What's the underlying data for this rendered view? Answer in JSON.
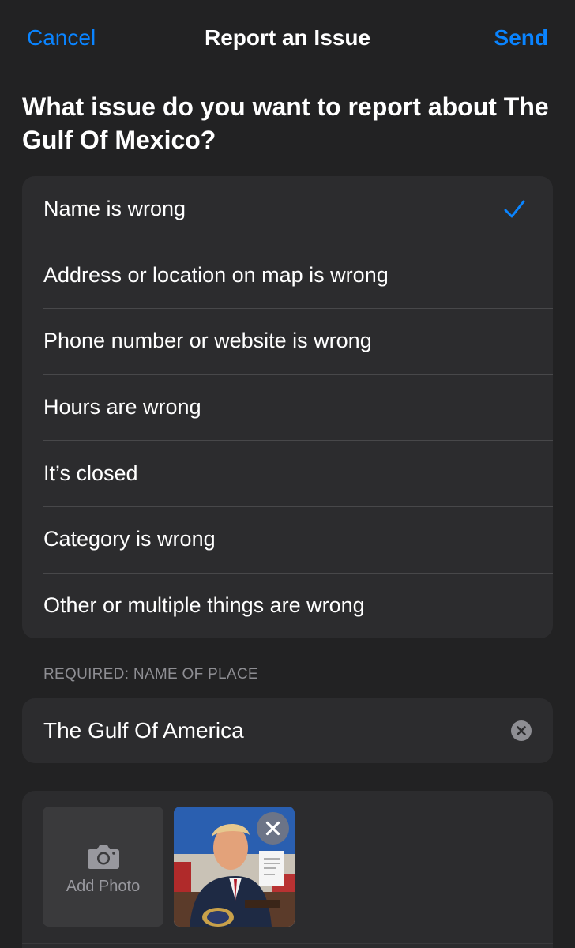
{
  "nav": {
    "cancel_label": "Cancel",
    "title": "Report an Issue",
    "send_label": "Send"
  },
  "question": "What issue do you want to report about The Gulf Of Mexico?",
  "options": [
    {
      "label": "Name is wrong",
      "selected": true
    },
    {
      "label": "Address or location on map is wrong",
      "selected": false
    },
    {
      "label": "Phone number or website is wrong",
      "selected": false
    },
    {
      "label": "Hours are wrong",
      "selected": false
    },
    {
      "label": "It’s closed",
      "selected": false
    },
    {
      "label": "Category is wrong",
      "selected": false
    },
    {
      "label": "Other or multiple things are wrong",
      "selected": false
    }
  ],
  "name_section": {
    "header": "REQUIRED: NAME OF PLACE",
    "value": "The Gulf Of America"
  },
  "photos": {
    "add_label": "Add Photo"
  },
  "icons": {
    "checkmark": "checkmark-icon",
    "clear": "clear-icon",
    "camera": "camera-icon",
    "remove_photo": "close-icon"
  },
  "colors": {
    "accent": "#0a84ff",
    "background": "#222223",
    "card": "#2c2c2e"
  }
}
